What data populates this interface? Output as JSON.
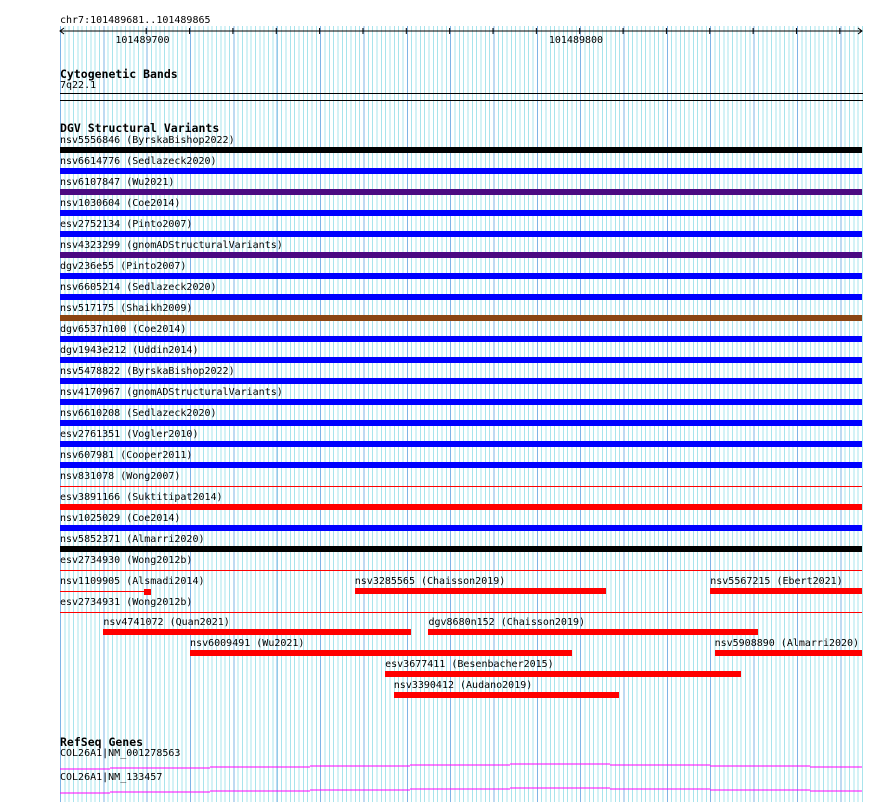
{
  "ruler": {
    "title": "chr7:101489681..101489865",
    "start": 101489681,
    "end": 101489865,
    "tick_labels": [
      {
        "label": "101489700",
        "pos": 101489700
      },
      {
        "label": "101489800",
        "pos": 101489800
      }
    ]
  },
  "cytoband": {
    "title": "Cytogenetic Bands",
    "band": "7q22.1"
  },
  "dgv": {
    "title": "DGV Structural Variants",
    "colors": {
      "black": "#000000",
      "blue": "#0000ff",
      "purple": "#4b0a82",
      "brown": "#8b4513",
      "red": "#ff0000"
    },
    "rows": [
      [
        {
          "label": "nsv5556846 (ByrskaBishop2022)",
          "color": "black",
          "full": true
        }
      ],
      [
        {
          "label": "nsv6614776 (Sedlazeck2020)",
          "color": "blue",
          "full": true
        }
      ],
      [
        {
          "label": "nsv6107847 (Wu2021)",
          "color": "purple",
          "full": true
        }
      ],
      [
        {
          "label": "nsv1030604 (Coe2014)",
          "color": "blue",
          "full": true
        }
      ],
      [
        {
          "label": "esv2752134 (Pinto2007)",
          "color": "blue",
          "full": true
        }
      ],
      [
        {
          "label": "nsv4323299 (gnomADStructuralVariants)",
          "color": "purple",
          "full": true
        }
      ],
      [
        {
          "label": "dgv236e55 (Pinto2007)",
          "color": "blue",
          "full": true
        }
      ],
      [
        {
          "label": "nsv6605214 (Sedlazeck2020)",
          "color": "blue",
          "full": true
        }
      ],
      [
        {
          "label": "nsv517175 (Shaikh2009)",
          "color": "brown",
          "full": true
        }
      ],
      [
        {
          "label": "dgv6537n100 (Coe2014)",
          "color": "blue",
          "full": true
        }
      ],
      [
        {
          "label": "dgv1943e212 (Uddin2014)",
          "color": "blue",
          "full": true
        }
      ],
      [
        {
          "label": "nsv5478822 (ByrskaBishop2022)",
          "color": "blue",
          "full": true
        }
      ],
      [
        {
          "label": "nsv4170967 (gnomADStructuralVariants)",
          "color": "blue",
          "full": true
        }
      ],
      [
        {
          "label": "nsv6610208 (Sedlazeck2020)",
          "color": "blue",
          "full": true
        }
      ],
      [
        {
          "label": "esv2761351 (Vogler2010)",
          "color": "blue",
          "full": true
        }
      ],
      [
        {
          "label": "nsv607981 (Cooper2011)",
          "color": "blue",
          "full": true
        }
      ],
      [
        {
          "label": "nsv831078 (Wong2007)",
          "color": "red",
          "full": true,
          "thin": true
        }
      ],
      [
        {
          "label": "esv3891166 (Suktitipat2014)",
          "color": "red",
          "full": true
        }
      ],
      [
        {
          "label": "nsv1025029 (Coe2014)",
          "color": "blue",
          "full": true
        }
      ],
      [
        {
          "label": "nsv5852371 (Almarri2020)",
          "color": "black",
          "full": true
        }
      ],
      [
        {
          "label": "esv2734930 (Wong2012b)",
          "color": "red",
          "full": true,
          "thin": true
        }
      ],
      [
        {
          "label": "nsv1109905 (Alsmadi2014)",
          "color": "red",
          "start": 101489681,
          "end": 101489702,
          "thin_with_end_box": true
        },
        {
          "label": "nsv3285565 (Chaisson2019)",
          "color": "red",
          "start": 101489749,
          "end": 101489807
        },
        {
          "label": "nsv5567215 (Ebert2021)",
          "color": "red",
          "start": 101489831,
          "end": 101489866
        }
      ],
      [
        {
          "label": "esv2734931 (Wong2012b)",
          "color": "red",
          "full": true,
          "thin": true
        }
      ],
      [
        {
          "label": "nsv4741072 (Quan2021)",
          "color": "red",
          "start": 101489691,
          "end": 101489762
        },
        {
          "label": "dgv8680n152 (Chaisson2019)",
          "color": "red",
          "start": 101489766,
          "end": 101489842
        }
      ],
      [
        {
          "label": "nsv6009491 (Wu2021)",
          "color": "red",
          "start": 101489711,
          "end": 101489799
        },
        {
          "label": "nsv5908890 (Almarri2020)",
          "color": "red",
          "start": 101489832,
          "end": 101489866
        }
      ],
      [
        {
          "label": "esv3677411 (Besenbacher2015)",
          "color": "red",
          "start": 101489756,
          "end": 101489838
        }
      ],
      [
        {
          "label": "nsv3390412 (Audano2019)",
          "color": "red",
          "start": 101489758,
          "end": 101489810
        }
      ]
    ]
  },
  "refseq": {
    "title": "RefSeq Genes",
    "color": "#ff00ff",
    "genes": [
      {
        "label": "COL26A1|NM_001278563"
      },
      {
        "label": "COL26A1|NM_133457"
      }
    ]
  }
}
